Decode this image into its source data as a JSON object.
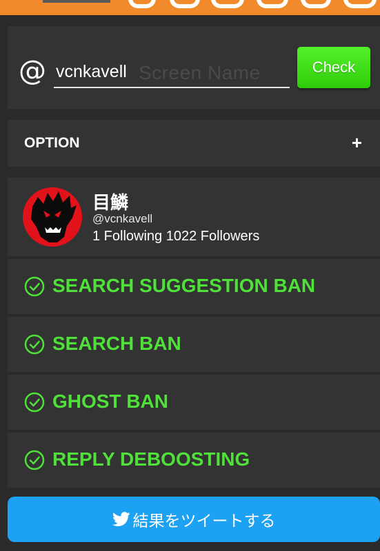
{
  "username_field": {
    "value": "vcnkavell",
    "placeholder": "Screen Name",
    "at_symbol": "@"
  },
  "check_button": {
    "label": "Check"
  },
  "options": {
    "label": "OPTION",
    "toggle": "+"
  },
  "profile": {
    "display_name": "目鱗",
    "handle": "@vcnkavell",
    "follow_counts": "1 Following 1022 Followers"
  },
  "checks": [
    {
      "label": "SEARCH SUGGESTION BAN",
      "icon": "check-circle-icon",
      "status": "ok"
    },
    {
      "label": "SEARCH BAN",
      "icon": "check-circle-icon",
      "status": "ok"
    },
    {
      "label": "GHOST BAN",
      "icon": "check-circle-icon",
      "status": "ok"
    },
    {
      "label": "REPLY DEBOOSTING",
      "icon": "check-circle-icon",
      "status": "ok"
    }
  ],
  "tweet_button": {
    "label": "結果をツイートする",
    "icon": "twitter-bird-icon"
  },
  "colors": {
    "page_background": "#2a2a2a",
    "card_background": "#333333",
    "banner_orange": "#f08a2a",
    "check_green": "#4fe13a",
    "button_green": "#3ed91a",
    "tweet_blue": "#1da1f2",
    "avatar_red": "#e2121a"
  }
}
